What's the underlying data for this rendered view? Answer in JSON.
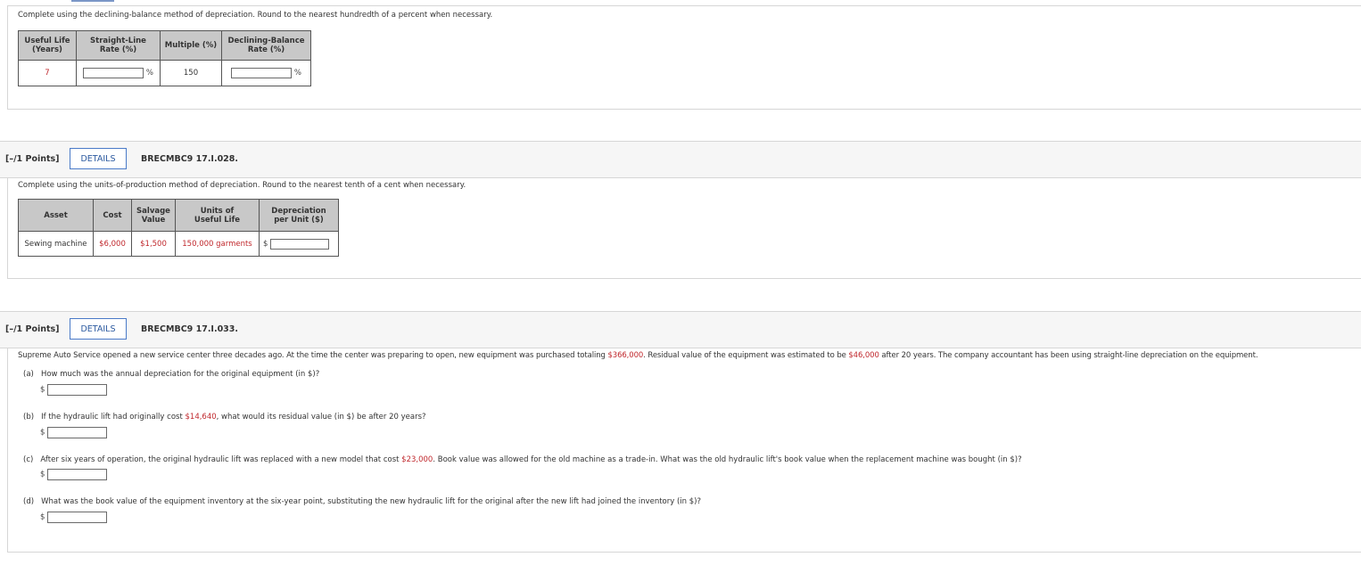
{
  "q1": {
    "instruction": "Complete using the declining-balance method of depreciation. Round to the nearest hundredth of a percent when necessary.",
    "headers": [
      "Useful Life (Years)",
      "Straight-Line Rate (%)",
      "Multiple (%)",
      "Declining-Balance Rate (%)"
    ],
    "header_lines": [
      [
        "Useful Life",
        "(Years)"
      ],
      [
        "Straight-Line",
        "Rate (%)"
      ],
      [
        "Multiple (%)"
      ],
      [
        "Declining-Balance",
        "Rate (%)"
      ]
    ],
    "useful_life": "7",
    "percent_sign": "%",
    "multiple": "150"
  },
  "q2": {
    "points": "[–/1 Points]",
    "details_label": "DETAILS",
    "id": "BRECMBC9 17.I.028.",
    "instruction": "Complete using the units-of-production method of depreciation. Round to the nearest tenth of a cent when necessary.",
    "header_lines": [
      [
        "Asset"
      ],
      [
        "Cost"
      ],
      [
        "Salvage",
        "Value"
      ],
      [
        "Units of",
        "Useful Life"
      ],
      [
        "Depreciation",
        "per Unit ($)"
      ]
    ],
    "asset": "Sewing machine",
    "cost": "$6,000",
    "salvage": "$1,500",
    "units": "150,000 garments",
    "dollar": "$"
  },
  "q3": {
    "points": "[–/1 Points]",
    "details_label": "DETAILS",
    "id": "BRECMBC9 17.I.033.",
    "intro_1": "Supreme Auto Service opened a new service center three decades ago. At the time the center was preparing to open, new equipment was purchased totaling ",
    "intro_amount": "$366,000",
    "intro_2": ". Residual value of the equipment was estimated to be ",
    "intro_residual": "$46,000",
    "intro_3": " after 20 years. The company accountant has been using straight-line depreciation on the equipment.",
    "a_label": "(a)",
    "a_text": "How much was the annual depreciation for the original equipment (in $)?",
    "b_label": "(b)",
    "b_text_1": "If the hydraulic lift had originally cost ",
    "b_amount": "$14,640",
    "b_text_2": ", what would its residual value (in $) be after 20 years?",
    "c_label": "(c)",
    "c_text_1": "After six years of operation, the original hydraulic lift was replaced with a new model that cost ",
    "c_amount": "$23,000",
    "c_text_2": ". Book value was allowed for the old machine as a trade-in. What was the old hydraulic lift's book value when the replacement machine was bought (in $)?",
    "d_label": "(d)",
    "d_text": "What was the book value of the equipment inventory at the six-year point, substituting the new hydraulic lift for the original after the new lift had joined the inventory (in $)?",
    "dollar": "$"
  },
  "colors": {
    "accent_red": "#c0282d",
    "button_blue": "#4a7ac8",
    "header_gray": "#c8c8c8"
  }
}
